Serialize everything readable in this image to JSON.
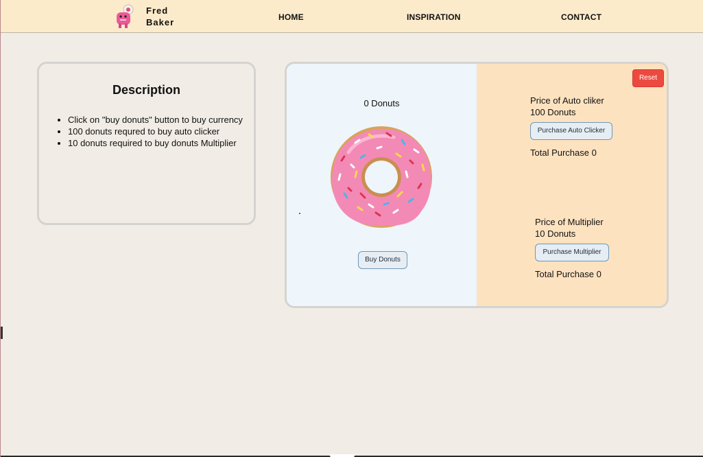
{
  "brand": {
    "name_line1": "Fred",
    "name_line2": "Baker",
    "logo_icon": "donut-mascot-icon"
  },
  "nav": {
    "home": "HOME",
    "inspiration": "INSPIRATION",
    "contact": "CONTACT"
  },
  "description": {
    "title": "Description",
    "items": [
      "Click on \"buy donuts\" button to buy currency",
      "100 donuts requred to buy auto clicker",
      "10 donuts required to buy donuts Multiplier"
    ]
  },
  "game": {
    "donut_count": "0 Donuts",
    "buy_button": "Buy Donuts",
    "reset_button": "Reset",
    "auto_clicker": {
      "price_label": "Price of Auto cliker",
      "price_value": "100 Donuts",
      "button": "Purchase Auto Clicker",
      "total": "Total Purchase 0"
    },
    "multiplier": {
      "price_label": "Price of Multiplier",
      "price_value": "10 Donuts",
      "button": "Purchase Multiplier",
      "total": "Total Purchase 0"
    }
  },
  "colors": {
    "navbar": "#fcebcb",
    "page_bg": "#f1ede6",
    "donut_panel": "#eef5fb",
    "shop_panel": "#fde2c0",
    "reset": "#ec4a40",
    "frosting": "#f38ab6"
  }
}
